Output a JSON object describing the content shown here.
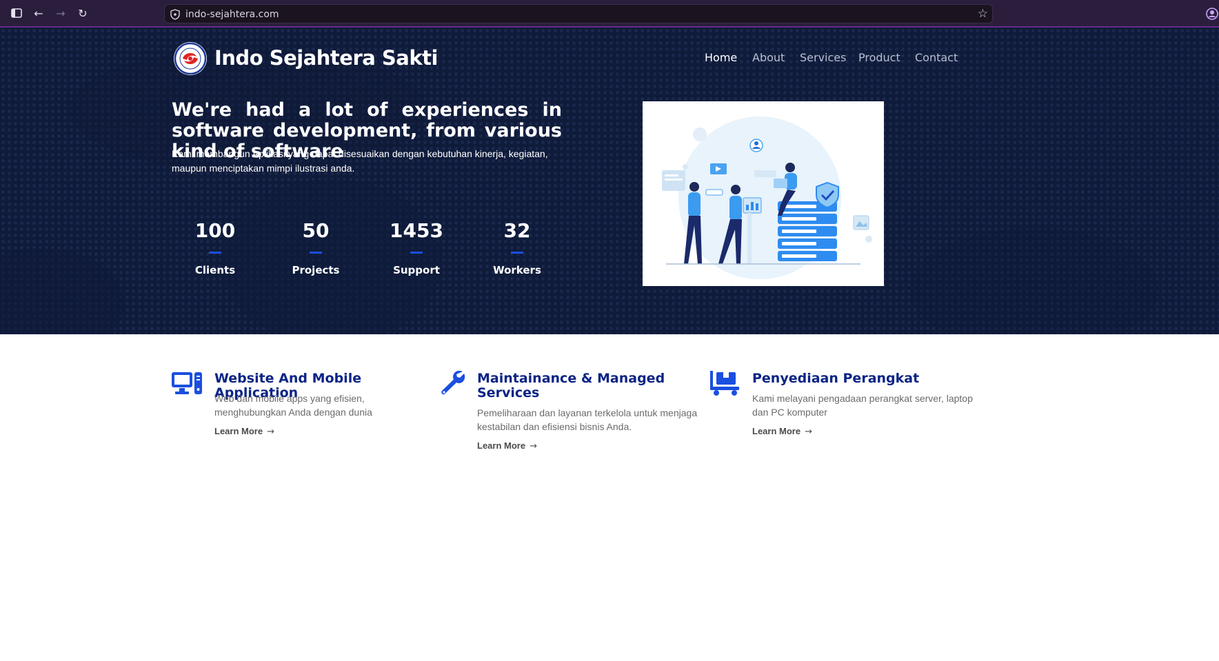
{
  "browser": {
    "url": "indo-sejahtera.com"
  },
  "header": {
    "brand": "Indo Sejahtera Sakti",
    "logo_text": "PT INDO SEJAHTERA SAKTI",
    "nav": [
      {
        "label": "Home",
        "active": true
      },
      {
        "label": "About",
        "active": false
      },
      {
        "label": "Services",
        "active": false
      },
      {
        "label": "Product",
        "active": false
      },
      {
        "label": "Contact",
        "active": false
      }
    ]
  },
  "hero": {
    "headline": "We're had a lot of experiences in software development, from various kind of software",
    "subtext": "Kami membangun Aplikasi yang dapat disesuaikan dengan kebutuhan kinerja, kegiatan, maupun menciptakan mimpi ilustrasi anda.",
    "stats": [
      {
        "value": "100",
        "label": "Clients"
      },
      {
        "value": "50",
        "label": "Projects"
      },
      {
        "value": "1453",
        "label": "Support"
      },
      {
        "value": "32",
        "label": "Workers"
      }
    ]
  },
  "services": [
    {
      "icon": "desktop-icon",
      "title": "Website And Mobile Application",
      "desc": "Web dan mobile apps yang efisien, menghubungkan Anda dengan dunia",
      "link": "Learn More"
    },
    {
      "icon": "wrench-icon",
      "title": "Maintainance & Managed Services",
      "desc": "Pemeliharaan dan layanan terkelola untuk menjaga kestabilan dan efisiensi bisnis Anda.",
      "link": "Learn More"
    },
    {
      "icon": "dolly-icon",
      "title": "Penyediaan Perangkat",
      "desc": "Kami melayani pengadaan perangkat server, laptop dan PC komputer",
      "link": "Learn More"
    }
  ],
  "colors": {
    "hero_bg": "#0f1b3a",
    "accent": "#1a4fe0",
    "title_blue": "#0b2486",
    "chrome_bg": "#2b1e3d"
  }
}
